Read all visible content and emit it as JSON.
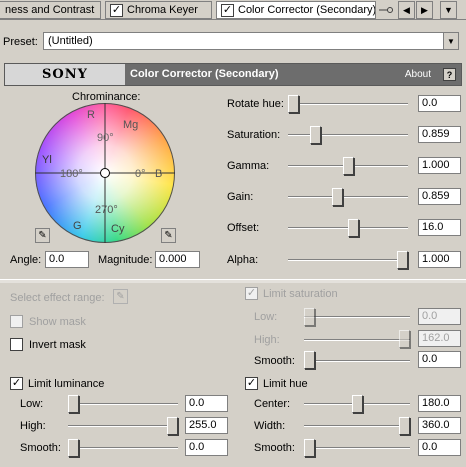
{
  "tabs": {
    "items": [
      {
        "label": "ness and Contrast"
      },
      {
        "label": "Chroma Keyer",
        "checked": "✓"
      },
      {
        "label": "Color Corrector (Secondary)",
        "checked": "✓"
      }
    ],
    "prev": "◀",
    "next": "▶",
    "menu": "▼"
  },
  "preset": {
    "label": "Preset:",
    "value": "(Untitled)"
  },
  "header": {
    "brand": "SONY",
    "title": "Color Corrector (Secondary)",
    "about": "About",
    "help": "?"
  },
  "wheel": {
    "label": "Chrominance:",
    "marks": {
      "r": "R",
      "mg": "Mg",
      "b": "B",
      "cy": "Cy",
      "g": "G",
      "yl": "Yl",
      "d90": "90°",
      "d0": "0°",
      "d180": "180°",
      "d270": "270°"
    }
  },
  "angle": {
    "label": "Angle:",
    "value": "0.0"
  },
  "magnitude": {
    "label": "Magnitude:",
    "value": "0.000"
  },
  "controls": {
    "rotate_hue": {
      "label": "Rotate hue:",
      "value": "0.0",
      "level": 0.0
    },
    "saturation": {
      "label": "Saturation:",
      "value": "0.859",
      "level": 0.2
    },
    "gamma": {
      "label": "Gamma:",
      "value": "1.000",
      "level": 0.5
    },
    "gain": {
      "label": "Gain:",
      "value": "0.859",
      "level": 0.4
    },
    "offset": {
      "label": "Offset:",
      "value": "16.0",
      "level": 0.55
    },
    "alpha": {
      "label": "Alpha:",
      "value": "1.000",
      "level": 1.0
    }
  },
  "effect_range": {
    "label": "Select effect range:",
    "show_mask": "Show mask",
    "invert_mask": "Invert mask"
  },
  "limit_saturation": {
    "label": "Limit saturation",
    "checked": "✓",
    "low": {
      "label": "Low:",
      "value": "0.0",
      "level": 0.0
    },
    "high": {
      "label": "High:",
      "value": "162.0",
      "level": 1.0
    },
    "smooth": {
      "label": "Smooth:",
      "value": "0.0",
      "level": 0.0
    }
  },
  "limit_luminance": {
    "label": "Limit luminance",
    "checked": "✓",
    "low": {
      "label": "Low:",
      "value": "0.0",
      "level": 0.0
    },
    "high": {
      "label": "High:",
      "value": "255.0",
      "level": 1.0
    },
    "smooth": {
      "label": "Smooth:",
      "value": "0.0",
      "level": 0.0
    }
  },
  "limit_hue": {
    "label": "Limit hue",
    "checked": "✓",
    "center": {
      "label": "Center:",
      "value": "180.0",
      "level": 0.5
    },
    "width": {
      "label": "Width:",
      "value": "360.0",
      "level": 1.0
    },
    "smooth": {
      "label": "Smooth:",
      "value": "0.0",
      "level": 0.0
    }
  },
  "colors": {
    "header_bg": "#6d6d6d",
    "panel_bg": "#d4d0c8"
  }
}
